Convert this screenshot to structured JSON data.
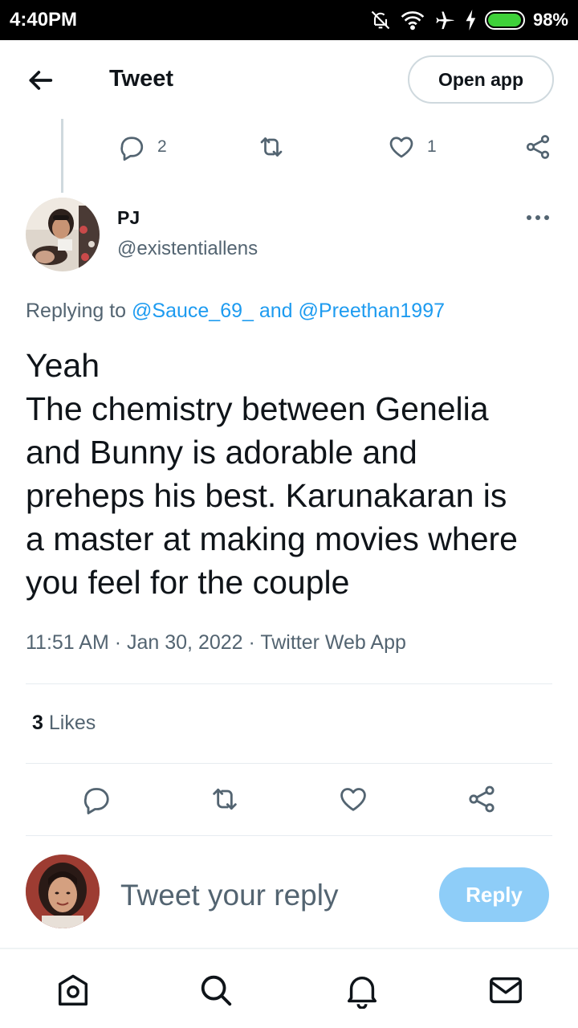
{
  "status_bar": {
    "time": "4:40PM",
    "battery_percent": "98%",
    "battery_level": 0.98,
    "icons": [
      "mute-bell-icon",
      "wifi-icon",
      "airplane-icon",
      "charging-icon",
      "battery-icon"
    ]
  },
  "header": {
    "title": "Tweet",
    "open_app_label": "Open app"
  },
  "parent_tweet_actions": {
    "reply_count": "2",
    "like_count": "1"
  },
  "tweet": {
    "author_name": "PJ",
    "author_handle": "@existentiallens",
    "replying_prefix": "Replying to",
    "replying_mention_1": "@Sauce_69_",
    "replying_conjunction": "and",
    "replying_mention_2": "@Preethan1997",
    "text_lines": [
      "Yeah",
      "The chemistry between Genelia",
      "and Bunny is adorable and",
      "preheps his best. Karunakaran is",
      "a master at making movies where",
      "you feel for the couple"
    ],
    "meta": "11:51 AM · Jan 30, 2022 · Twitter Web App",
    "likes_count": "3",
    "likes_label": "Likes"
  },
  "composer": {
    "placeholder": "Tweet your reply",
    "reply_button": "Reply"
  },
  "colors": {
    "accent": "#1d9bf0",
    "reply_button_disabled": "#8ecdf8",
    "secondary_text": "#536471",
    "battery": "#3fd13a"
  },
  "bottom_nav": [
    "home-icon",
    "search-icon",
    "notifications-icon",
    "messages-icon"
  ]
}
